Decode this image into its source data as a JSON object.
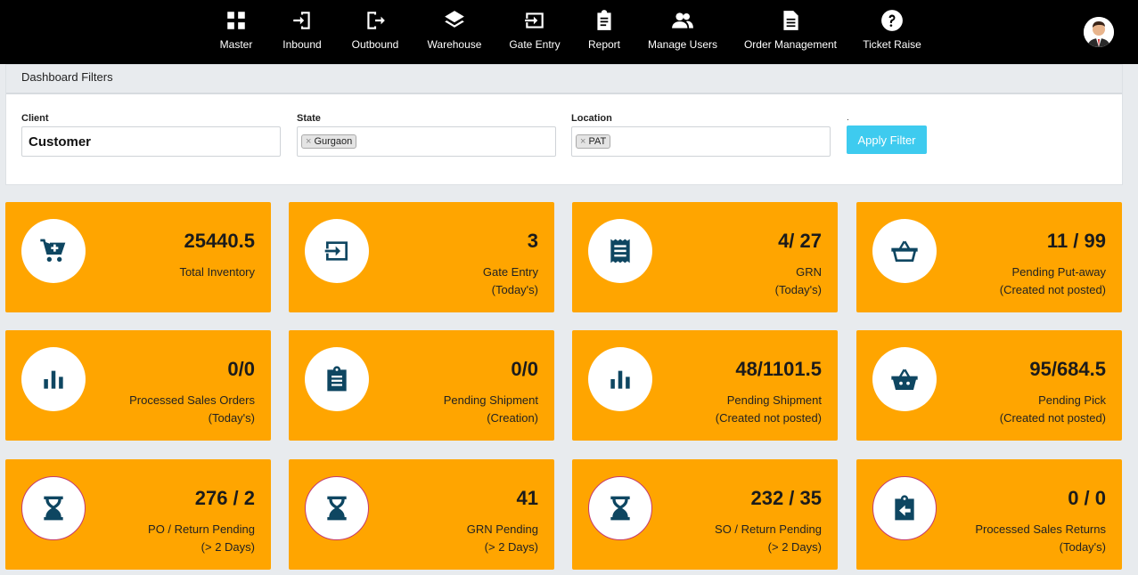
{
  "nav": [
    {
      "label": "Master",
      "icon": "master-icon"
    },
    {
      "label": "Inbound",
      "icon": "inbound-icon"
    },
    {
      "label": "Outbound",
      "icon": "outbound-icon"
    },
    {
      "label": "Warehouse",
      "icon": "layers-icon"
    },
    {
      "label": "Gate Entry",
      "icon": "gate-entry-icon"
    },
    {
      "label": "Report",
      "icon": "clipboard-icon"
    },
    {
      "label": "Manage Users",
      "icon": "users-icon"
    },
    {
      "label": "Order Management",
      "icon": "document-icon"
    },
    {
      "label": "Ticket Raise",
      "icon": "help-icon"
    }
  ],
  "filters": {
    "title": "Dashboard Filters",
    "client_label": "Client",
    "client_value": "Customer",
    "state_label": "State",
    "state_tag": "Gurgaon",
    "location_label": "Location",
    "location_tag": "PAT",
    "apply_label": "Apply Filter",
    "dot": "."
  },
  "colors": {
    "card": "#ffa500",
    "icon": "#0e4661",
    "apply": "#3ecbef",
    "topbar": "#000000"
  },
  "cards": [
    {
      "value": "25440.5",
      "line1": "Total Inventory",
      "line2": "",
      "icon": "cart-plus-icon"
    },
    {
      "value": "3",
      "line1": "Gate Entry",
      "line2": "(Today's)",
      "icon": "sign-in-icon"
    },
    {
      "value": "4/ 27",
      "line1": "GRN",
      "line2": "(Today's)",
      "icon": "receipt-icon"
    },
    {
      "value": "11 / 99",
      "line1": "Pending Put-away",
      "line2": "(Created not posted)",
      "icon": "basket-icon"
    },
    {
      "value": "0/0",
      "line1": "Processed Sales Orders",
      "line2": "(Today's)",
      "icon": "bar-chart-icon"
    },
    {
      "value": "0/0",
      "line1": "Pending Shipment",
      "line2": "(Creation)",
      "icon": "clipboard-list-icon"
    },
    {
      "value": "48/1101.5",
      "line1": "Pending Shipment",
      "line2": "(Created not posted)",
      "icon": "bar-chart-icon"
    },
    {
      "value": "95/684.5",
      "line1": "Pending Pick",
      "line2": "(Created not posted)",
      "icon": "shopping-basket-icon"
    },
    {
      "value": "276 / 2",
      "line1": "PO / Return Pending",
      "line2": "(> 2 Days)",
      "icon": "hourglass-icon"
    },
    {
      "value": "41",
      "line1": "GRN Pending",
      "line2": "(> 2 Days)",
      "icon": "hourglass-icon"
    },
    {
      "value": "232 / 35",
      "line1": "SO / Return Pending",
      "line2": "(> 2 Days)",
      "icon": "hourglass-icon"
    },
    {
      "value": "0 / 0",
      "line1": "Processed Sales Returns",
      "line2": "(Today's)",
      "icon": "return-clipboard-icon"
    }
  ]
}
